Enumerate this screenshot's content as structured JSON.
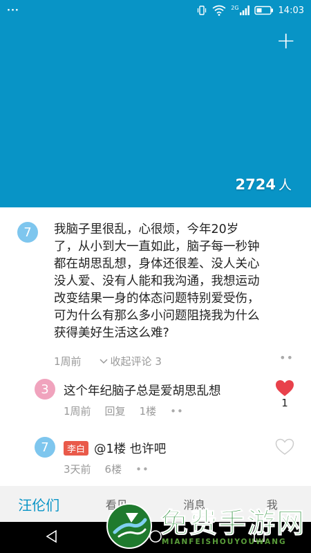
{
  "status_bar": {
    "left": "···",
    "network": "2G",
    "time": "14:03"
  },
  "header": {
    "add_label": "+",
    "people_count": "2724",
    "people_unit": "人"
  },
  "post": {
    "avatar_number": "7",
    "text": "我脑子里很乱，心很烦，今年20岁了，从小到大一直如此，脑子每一秒钟都在胡思乱想，身体还很差、没人关心没人爱、没有人能和我沟通，我想运动改变结果一身的体态问题特别爱受伤，可为什么有那么多小问题阻挠我为什么获得美好生活这么难?",
    "time": "1周前",
    "collapse_label": "收起评论 3",
    "more": "••"
  },
  "replies": [
    {
      "avatar_number": "3",
      "tag": "",
      "text": "这个年纪脑子总是爱胡思乱想",
      "time": "1周前",
      "reply_label": "回复",
      "floor": "1楼",
      "more": "••",
      "likes": "1",
      "liked": true
    },
    {
      "avatar_number": "7",
      "tag": "李白",
      "text": "@1楼 也许吧",
      "time": "3天前",
      "floor": "6楼",
      "more": "••",
      "liked": false
    }
  ],
  "tabs": [
    {
      "label": "汪伦们",
      "active": true
    },
    {
      "label": "看见",
      "active": false
    },
    {
      "label": "消息",
      "active": false
    },
    {
      "label": "我",
      "active": false
    }
  ],
  "watermark": {
    "title": "免费手游网",
    "subtitle": "MIANFEISHOUYOUWANG"
  },
  "colors": {
    "accent": "#0894c6",
    "heart": "#e8414b",
    "tag": "#e95a4a"
  }
}
